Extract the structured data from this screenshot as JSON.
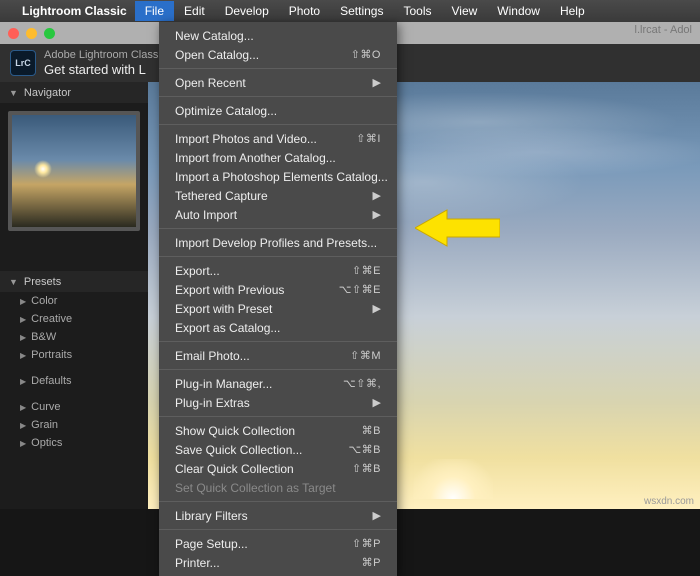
{
  "menubar": {
    "app_name": "Lightroom Classic",
    "items": [
      "File",
      "Edit",
      "Develop",
      "Photo",
      "Settings",
      "Tools",
      "View",
      "Window",
      "Help"
    ],
    "active_index": 0
  },
  "window": {
    "doc_title": "l.lrcat - Adol"
  },
  "toolbar": {
    "icon_text": "LrC",
    "subtitle": "Adobe Lightroom Classic",
    "title": "Get started with L"
  },
  "sidebar": {
    "navigator": "Navigator",
    "presets_header": "Presets",
    "groups_a": [
      "Color",
      "Creative",
      "B&W",
      "Portraits"
    ],
    "groups_b": [
      "Defaults"
    ],
    "groups_c": [
      "Curve",
      "Grain",
      "Optics"
    ]
  },
  "file_menu": {
    "groups": [
      [
        {
          "label": "New Catalog...",
          "shortcut": "",
          "submenu": false,
          "disabled": false
        },
        {
          "label": "Open Catalog...",
          "shortcut": "⇧⌘O",
          "submenu": false,
          "disabled": false
        }
      ],
      [
        {
          "label": "Open Recent",
          "shortcut": "",
          "submenu": true,
          "disabled": false
        }
      ],
      [
        {
          "label": "Optimize Catalog...",
          "shortcut": "",
          "submenu": false,
          "disabled": false
        }
      ],
      [
        {
          "label": "Import Photos and Video...",
          "shortcut": "⇧⌘I",
          "submenu": false,
          "disabled": false
        },
        {
          "label": "Import from Another Catalog...",
          "shortcut": "",
          "submenu": false,
          "disabled": false
        },
        {
          "label": "Import a Photoshop Elements Catalog...",
          "shortcut": "",
          "submenu": false,
          "disabled": false
        },
        {
          "label": "Tethered Capture",
          "shortcut": "",
          "submenu": true,
          "disabled": false
        },
        {
          "label": "Auto Import",
          "shortcut": "",
          "submenu": true,
          "disabled": false
        }
      ],
      [
        {
          "label": "Import Develop Profiles and Presets...",
          "shortcut": "",
          "submenu": false,
          "disabled": false
        }
      ],
      [
        {
          "label": "Export...",
          "shortcut": "⇧⌘E",
          "submenu": false,
          "disabled": false
        },
        {
          "label": "Export with Previous",
          "shortcut": "⌥⇧⌘E",
          "submenu": false,
          "disabled": false
        },
        {
          "label": "Export with Preset",
          "shortcut": "",
          "submenu": true,
          "disabled": false
        },
        {
          "label": "Export as Catalog...",
          "shortcut": "",
          "submenu": false,
          "disabled": false
        }
      ],
      [
        {
          "label": "Email Photo...",
          "shortcut": "⇧⌘M",
          "submenu": false,
          "disabled": false
        }
      ],
      [
        {
          "label": "Plug-in Manager...",
          "shortcut": "⌥⇧⌘,",
          "submenu": false,
          "disabled": false
        },
        {
          "label": "Plug-in Extras",
          "shortcut": "",
          "submenu": true,
          "disabled": false
        }
      ],
      [
        {
          "label": "Show Quick Collection",
          "shortcut": "⌘B",
          "submenu": false,
          "disabled": false
        },
        {
          "label": "Save Quick Collection...",
          "shortcut": "⌥⌘B",
          "submenu": false,
          "disabled": false
        },
        {
          "label": "Clear Quick Collection",
          "shortcut": "⇧⌘B",
          "submenu": false,
          "disabled": false
        },
        {
          "label": "Set Quick Collection as Target",
          "shortcut": "",
          "submenu": false,
          "disabled": true
        }
      ],
      [
        {
          "label": "Library Filters",
          "shortcut": "",
          "submenu": true,
          "disabled": false
        }
      ],
      [
        {
          "label": "Page Setup...",
          "shortcut": "⇧⌘P",
          "submenu": false,
          "disabled": false
        },
        {
          "label": "Printer...",
          "shortcut": "⌘P",
          "submenu": false,
          "disabled": false
        }
      ]
    ]
  },
  "annotation": {
    "arrow_color": "#fde200"
  },
  "watermark": "wsxdn.com"
}
